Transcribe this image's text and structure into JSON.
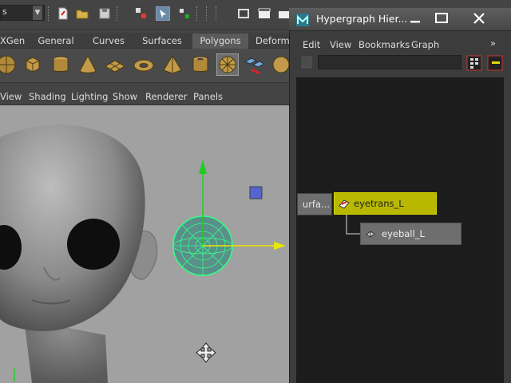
{
  "main": {
    "mode_select": "s",
    "shelf_tabs": [
      {
        "label": "XGen",
        "active": false
      },
      {
        "label": "General",
        "active": false
      },
      {
        "label": "Curves",
        "active": false
      },
      {
        "label": "Surfaces",
        "active": false
      },
      {
        "label": "Polygons",
        "active": true
      },
      {
        "label": "Deform",
        "active": false
      }
    ],
    "panel_menus": [
      "View",
      "Shading",
      "Lighting",
      "Show",
      "Renderer",
      "Panels"
    ]
  },
  "hypergraph": {
    "title": "Hypergraph Hier...",
    "menus": [
      "Edit",
      "View",
      "Bookmarks",
      "Graph"
    ],
    "overflow": "»",
    "nodes": {
      "surface_node": "urfa...",
      "eyetrans": "eyetrans_L",
      "eyeball": "eyeball_L"
    }
  },
  "colors": {
    "selected_node": "#b8b800",
    "graph_bg": "#1c1c1c",
    "viewport_bg": "#a1a1a1",
    "manip_y": "#22cc22",
    "manip_x": "#e8e800"
  }
}
